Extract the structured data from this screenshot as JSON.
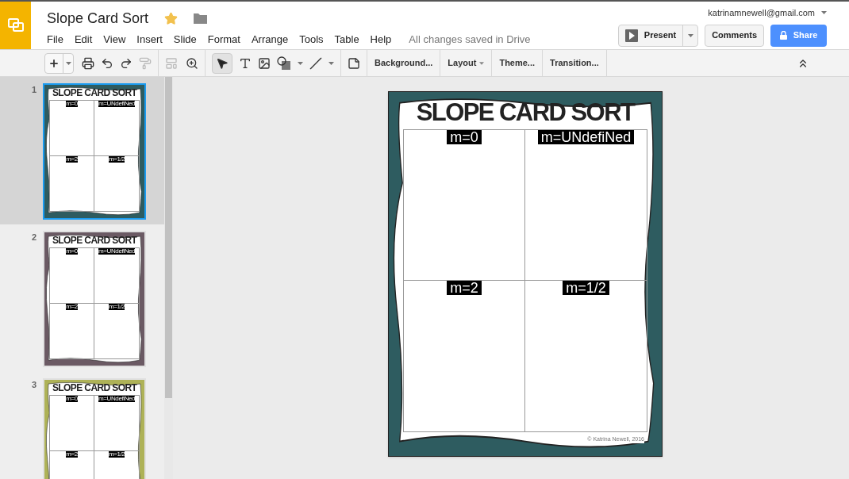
{
  "doc": {
    "title": "Slope Card Sort",
    "starred": true,
    "account": "katrinamnewell@gmail.com",
    "save_status": "All changes saved in Drive"
  },
  "menu": [
    "File",
    "Edit",
    "View",
    "Insert",
    "Slide",
    "Format",
    "Arrange",
    "Tools",
    "Table",
    "Help"
  ],
  "buttons": {
    "present": "Present",
    "comments": "Comments",
    "share": "Share"
  },
  "toolbar": [
    {
      "label": "Background...",
      "dropdown": false
    },
    {
      "label": "Layout",
      "dropdown": true
    },
    {
      "label": "Theme...",
      "dropdown": false
    },
    {
      "label": "Transition...",
      "dropdown": false
    }
  ],
  "slides": [
    {
      "number": "1",
      "selected": true,
      "color": "#2e5c60",
      "title": "SLOPE CARD SORT",
      "labels": [
        "m=0",
        "m=UNdefiNed",
        "m=2",
        "m=1/2"
      ]
    },
    {
      "number": "2",
      "selected": false,
      "color": "#6b5a64",
      "title": "SLOPE CARD SORT",
      "labels": [
        "m=0",
        "m=UNdefiNed",
        "m=2",
        "m=1/2"
      ]
    },
    {
      "number": "3",
      "selected": false,
      "color": "#aeb257",
      "title": "SLOPE CARD SORT",
      "labels": [
        "m=0",
        "m=UNdefiNed",
        "m=2",
        "m=1/2"
      ]
    }
  ],
  "canvas": {
    "title": "SLOPE CARD SORT",
    "labels": [
      "m=0",
      "m=UNdefiNed",
      "m=2",
      "m=1/2"
    ],
    "credit": "© Katrina Newell, 2016",
    "color": "#2e5c60"
  }
}
